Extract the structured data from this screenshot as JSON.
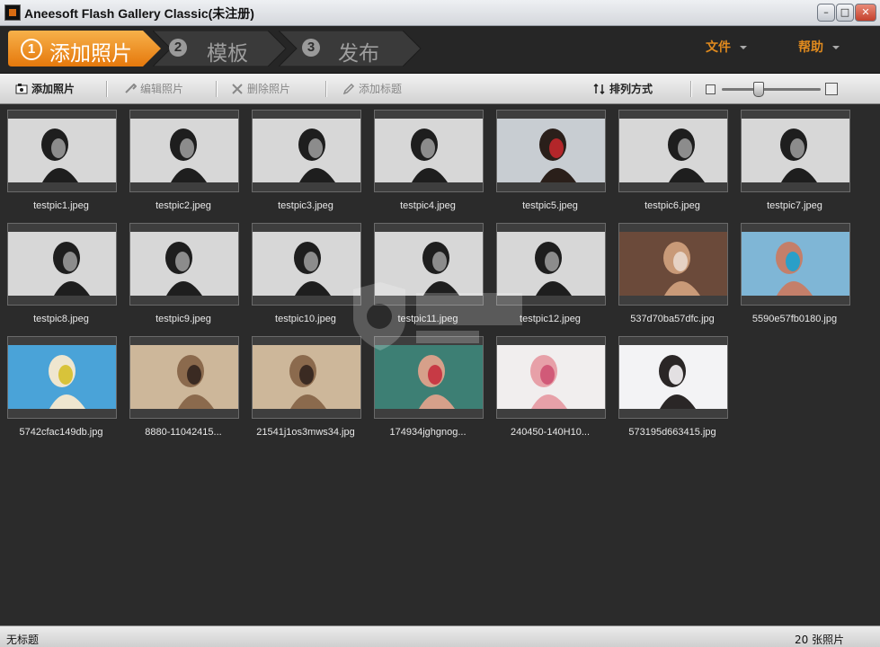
{
  "window": {
    "title": "Aneesoft Flash Gallery Classic(未注册)",
    "minimize": "–",
    "maximize": "□",
    "close": "✕"
  },
  "steps": [
    {
      "num": "1",
      "label": "添加照片"
    },
    {
      "num": "2",
      "label": "模板"
    },
    {
      "num": "3",
      "label": "发布"
    }
  ],
  "menu": {
    "file": "文件",
    "help": "帮助"
  },
  "toolbar": {
    "add_photo": "添加照片",
    "edit_photo": "编辑照片",
    "delete_photo": "删除照片",
    "add_title": "添加标题",
    "sort": "排列方式"
  },
  "photos": [
    {
      "name": "testpic1.jpeg",
      "tone": "bw"
    },
    {
      "name": "testpic2.jpeg",
      "tone": "bw"
    },
    {
      "name": "testpic3.jpeg",
      "tone": "bw"
    },
    {
      "name": "testpic4.jpeg",
      "tone": "bw"
    },
    {
      "name": "testpic5.jpeg",
      "tone": "color-red"
    },
    {
      "name": "testpic6.jpeg",
      "tone": "bw"
    },
    {
      "name": "testpic7.jpeg",
      "tone": "bw"
    },
    {
      "name": "testpic8.jpeg",
      "tone": "bw"
    },
    {
      "name": "testpic9.jpeg",
      "tone": "bw"
    },
    {
      "name": "testpic10.jpeg",
      "tone": "bw"
    },
    {
      "name": "testpic11.jpeg",
      "tone": "bw"
    },
    {
      "name": "testpic12.jpeg",
      "tone": "bw"
    },
    {
      "name": "537d70ba57dfc.jpg",
      "tone": "color-room"
    },
    {
      "name": "5590e57fb0180.jpg",
      "tone": "color-sea"
    },
    {
      "name": "5742cfac149db.jpg",
      "tone": "color-beach"
    },
    {
      "name": "8880-11042415...",
      "tone": "color-sand"
    },
    {
      "name": "21541j1os3mws34.jpg",
      "tone": "color-sand"
    },
    {
      "name": "174934jghgnog...",
      "tone": "color-water"
    },
    {
      "name": "240450-140H10...",
      "tone": "color-pink"
    },
    {
      "name": "573195d663415.jpg",
      "tone": "color-white"
    }
  ],
  "status": {
    "title": "无标题",
    "count": "20 张照片"
  },
  "colors": {
    "accent": "#f0921f",
    "background": "#2b2b2b",
    "menu_text": "#e08a1e"
  }
}
